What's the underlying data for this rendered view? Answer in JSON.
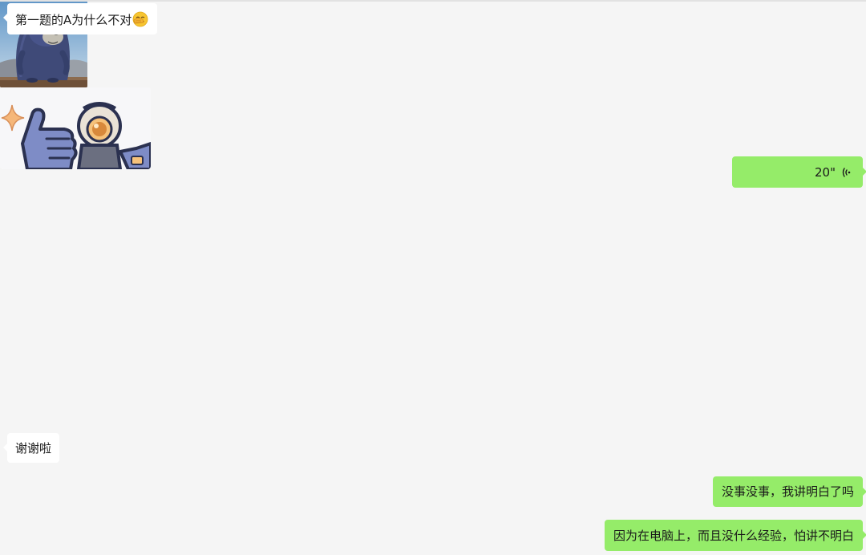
{
  "messages": {
    "msg1_text": "第一题的A为什么不对",
    "msg1_emoji": "facepalm-laugh-emoji",
    "mole_sticker": "mole-character-sticker",
    "voice_duration": "20\"",
    "thumbs_sticker": "thumbs-up-astronaut-sticker",
    "thanks_text": "谢谢啦",
    "reply1_text": "没事没事，我讲明白了吗",
    "reply2_text": "因为在电脑上，而且没什么经验，怕讲不明白"
  },
  "colors": {
    "background": "#f5f5f5",
    "incoming_bubble": "#ffffff",
    "outgoing_bubble": "#95ec69"
  }
}
